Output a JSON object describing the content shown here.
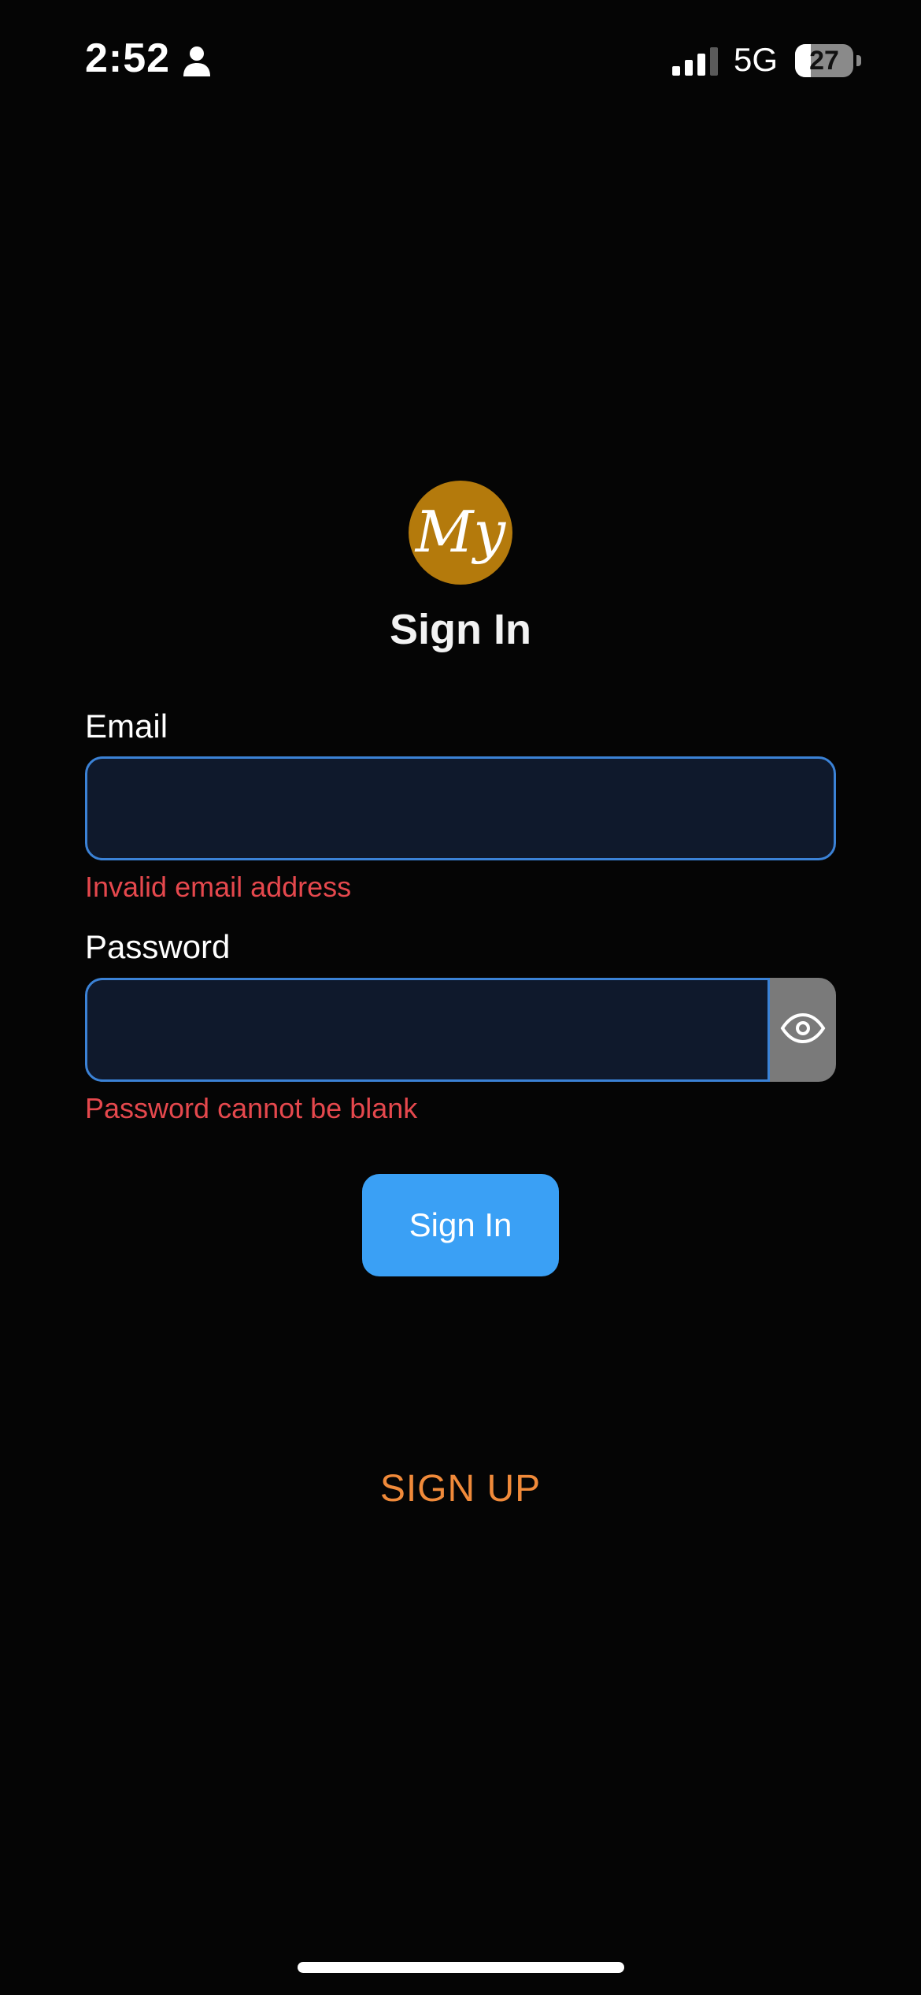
{
  "status_bar": {
    "time": "2:52",
    "network": "5G",
    "battery_level": "27",
    "battery_fraction": 0.27,
    "icons": [
      "person-icon",
      "signal-icon",
      "battery-icon"
    ]
  },
  "logo": {
    "text": "My",
    "color": "#b47a0c"
  },
  "page": {
    "title": "Sign In"
  },
  "form": {
    "email": {
      "label": "Email",
      "value": "",
      "placeholder": "",
      "error": "Invalid email address"
    },
    "password": {
      "label": "Password",
      "value": "",
      "placeholder": "",
      "error": "Password cannot be blank",
      "toggle_icon": "eye-icon"
    },
    "submit_label": "Sign In"
  },
  "signup": {
    "label": "SIGN UP"
  },
  "colors": {
    "background": "#050505",
    "input_background": "#0f192c",
    "input_border": "#3b82d6",
    "error": "#e5484d",
    "primary_button": "#3aa0f5",
    "signup_link": "#f08a3a"
  }
}
